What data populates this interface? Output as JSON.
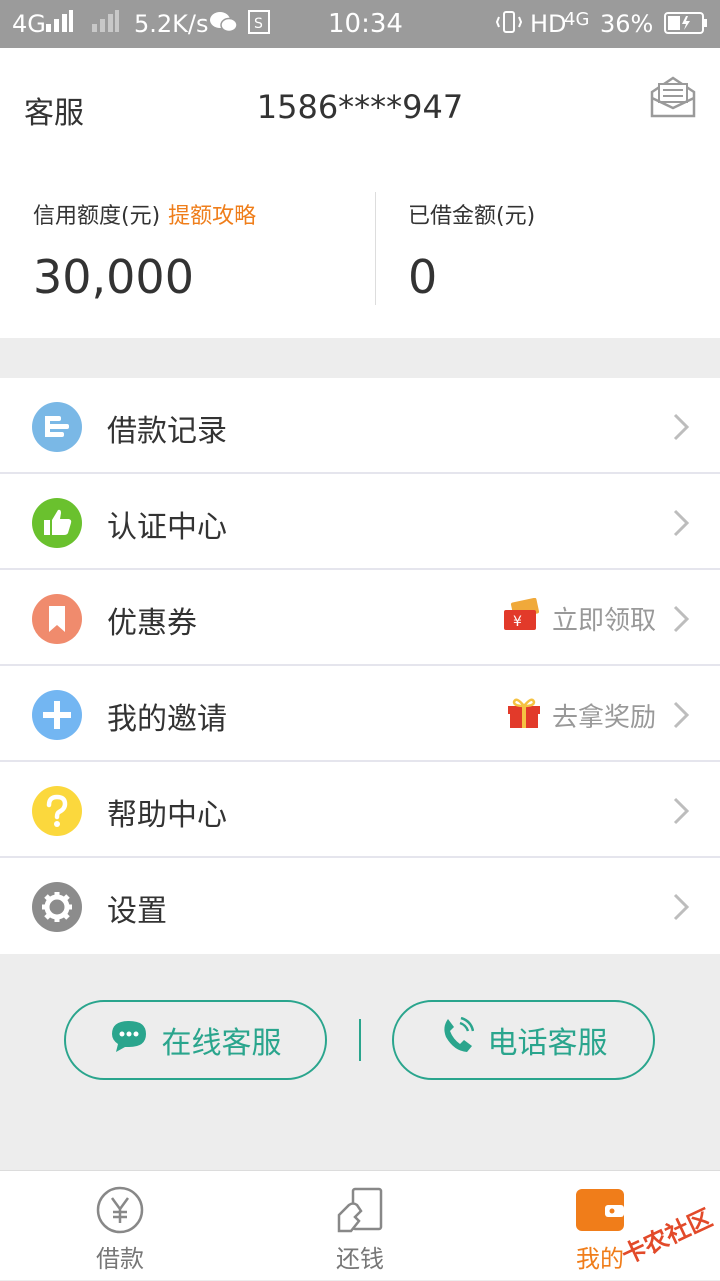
{
  "status_bar": {
    "network": "4G",
    "speed": "5.2K/s",
    "time": "10:34",
    "hd": "HD",
    "network2": "4G",
    "battery": "36%"
  },
  "header": {
    "service_label": "客服",
    "phone": "1586****947",
    "mail_icon": "message-box-icon"
  },
  "credit": {
    "limit_label": "信用额度(元)",
    "limit_link": "提额攻略",
    "limit_value": "30,000",
    "borrowed_label": "已借金额(元)",
    "borrowed_value": "0"
  },
  "menu": [
    {
      "label": "借款记录",
      "icon": "records-icon",
      "color": "#7ab8e6",
      "right_text": ""
    },
    {
      "label": "认证中心",
      "icon": "thumb-up-icon",
      "color": "#6ac12e",
      "right_text": ""
    },
    {
      "label": "优惠券",
      "icon": "bookmark-icon",
      "color": "#f08b6d",
      "right_text": "立即领取"
    },
    {
      "label": "我的邀请",
      "icon": "plus-icon",
      "color": "#73b6f2",
      "right_text": "去拿奖励"
    },
    {
      "label": "帮助中心",
      "icon": "question-icon",
      "color": "#fbd83d",
      "right_text": ""
    },
    {
      "label": "设置",
      "icon": "gear-icon",
      "color": "#8c8c8c",
      "right_text": ""
    }
  ],
  "service_buttons": {
    "online": "在线客服",
    "phone": "电话客服"
  },
  "tabs": [
    {
      "label": "借款",
      "icon": "yen-coin-icon"
    },
    {
      "label": "还钱",
      "icon": "repay-icon"
    },
    {
      "label": "我的",
      "icon": "wallet-icon"
    }
  ],
  "accent": "#f07d1a",
  "green": "#2aa58d",
  "watermark": "卡农社区"
}
